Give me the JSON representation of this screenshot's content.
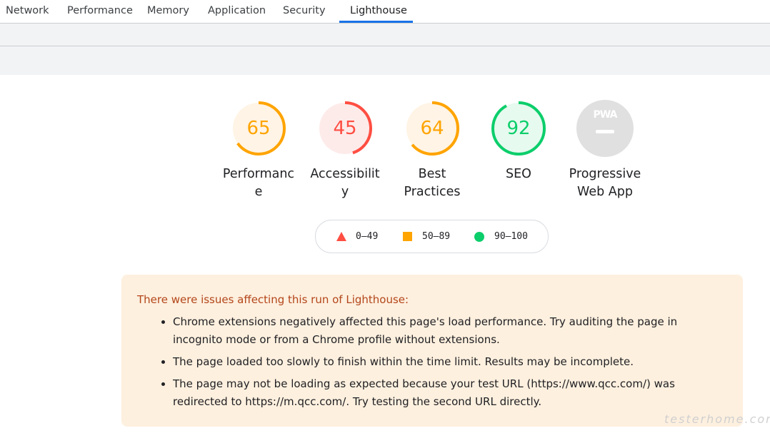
{
  "tabs": [
    "Network",
    "Performance",
    "Memory",
    "Application",
    "Security",
    "Lighthouse"
  ],
  "active_tab": "Lighthouse",
  "gauges": [
    {
      "score": "65",
      "label": "Performance",
      "label_lines": [
        "Performanc",
        "e"
      ],
      "fraction": 0.65,
      "status": "average"
    },
    {
      "score": "45",
      "label": "Accessibility",
      "label_lines": [
        "Accessibilit",
        "y"
      ],
      "fraction": 0.45,
      "status": "fail"
    },
    {
      "score": "64",
      "label": "Best Practices",
      "label_lines": [
        "Best",
        "Practices"
      ],
      "fraction": 0.64,
      "status": "average"
    },
    {
      "score": "92",
      "label": "SEO",
      "label_lines": [
        "SEO"
      ],
      "fraction": 0.92,
      "status": "pass"
    },
    {
      "score": "PWA",
      "label": "Progressive Web App",
      "label_lines": [
        "Progressive",
        "Web App"
      ],
      "status": "pwa"
    }
  ],
  "colors": {
    "fail": "#ff4e42",
    "average": "#ffa400",
    "pass": "#0cce6b",
    "fail_bg": "#fdebea",
    "average_bg": "#fff4e5",
    "pass_bg": "#e6faef",
    "pwa_bg": "#e0e0e0",
    "accent": "#1a73e8"
  },
  "legend": [
    {
      "range": "0–49",
      "shape": "triangle-icon"
    },
    {
      "range": "50–89",
      "shape": "square-icon"
    },
    {
      "range": "90–100",
      "shape": "circle-icon"
    }
  ],
  "warnings": {
    "title": "There were issues affecting this run of Lighthouse:",
    "items": [
      "Chrome extensions negatively affected this page's load performance. Try auditing the page in incognito mode or from a Chrome profile without extensions.",
      "The page loaded too slowly to finish within the time limit. Results may be incomplete.",
      "The page may not be loading as expected because your test URL (https://www.qcc.com/) was redirected to https://m.qcc.com/. Try testing the second URL directly."
    ]
  },
  "watermark": "testerhome.com"
}
